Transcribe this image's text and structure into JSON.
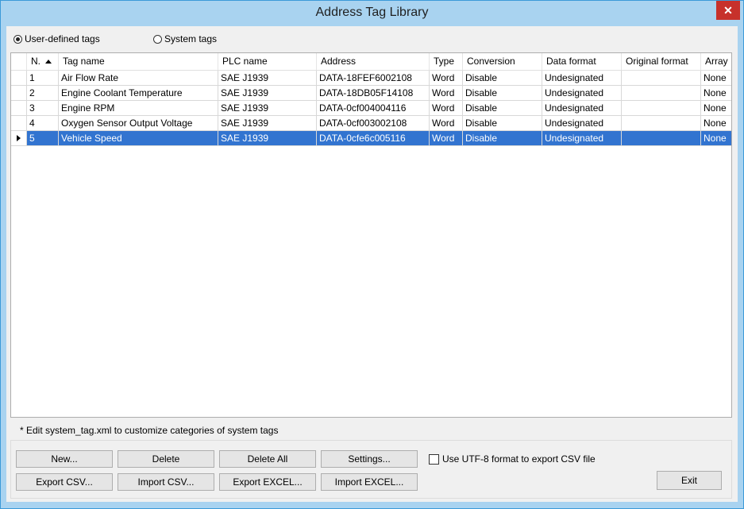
{
  "window": {
    "title": "Address Tag Library",
    "close_label": "✕"
  },
  "radio": {
    "user_defined": "User-defined tags",
    "system": "System tags"
  },
  "table": {
    "columns": [
      "N.",
      "Tag name",
      "PLC name",
      "Address",
      "Type",
      "Conversion",
      "Data format",
      "Original format",
      "Array"
    ],
    "rows": [
      [
        "1",
        "Air Flow Rate",
        "SAE J1939",
        "DATA-18FEF6002108",
        "Word",
        "Disable",
        "Undesignated",
        "",
        "None"
      ],
      [
        "2",
        "Engine Coolant Temperature",
        "SAE J1939",
        "DATA-18DB05F14108",
        "Word",
        "Disable",
        "Undesignated",
        "",
        "None"
      ],
      [
        "3",
        "Engine RPM",
        "SAE J1939",
        "DATA-0cf004004116",
        "Word",
        "Disable",
        "Undesignated",
        "",
        "None"
      ],
      [
        "4",
        "Oxygen Sensor Output Voltage",
        "SAE J1939",
        "DATA-0cf003002108",
        "Word",
        "Disable",
        "Undesignated",
        "",
        "None"
      ],
      [
        "5",
        "Vehicle Speed",
        "SAE J1939",
        "DATA-0cfe6c005116",
        "Word",
        "Disable",
        "Undesignated",
        "",
        "None"
      ]
    ],
    "selected_row": 4
  },
  "note": "* Edit system_tag.xml to customize categories of system tags",
  "buttons": {
    "new": "New...",
    "delete": "Delete",
    "delete_all": "Delete All",
    "settings": "Settings...",
    "export_csv": "Export CSV...",
    "import_csv": "Import CSV...",
    "export_excel": "Export EXCEL...",
    "import_excel": "Import EXCEL...",
    "exit": "Exit"
  },
  "utf8_checkbox": "Use UTF-8 format to export CSV file",
  "colors": {
    "selection": "#3274d0",
    "title_bar": "#a9d3f0",
    "close": "#c7312b"
  }
}
